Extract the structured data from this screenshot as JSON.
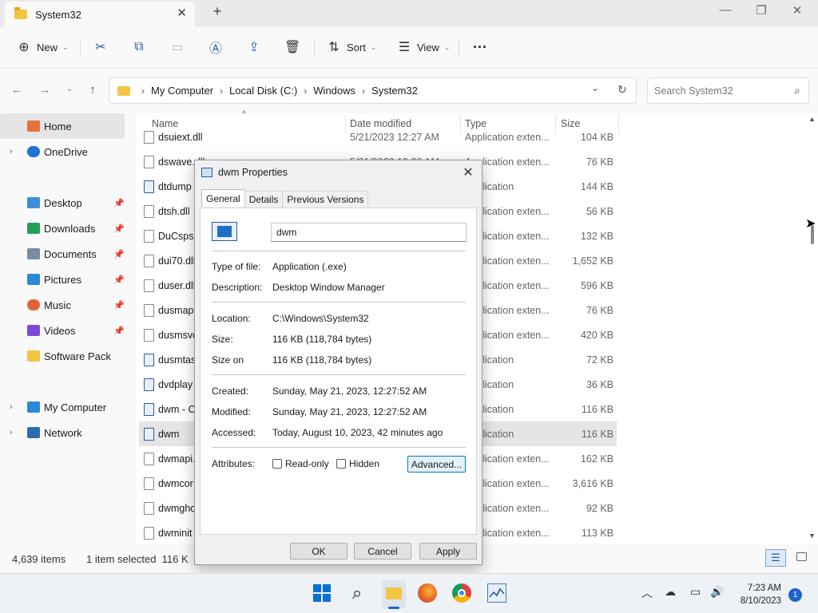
{
  "window": {
    "tab_title": "System32",
    "new_tab": "+",
    "minimize": "—",
    "maximize": "❐",
    "close": "✕"
  },
  "toolbar": {
    "new_label": "New",
    "sort_label": "Sort",
    "view_label": "View",
    "more": "···"
  },
  "address": {
    "crumbs": [
      "My Computer",
      "Local Disk (C:)",
      "Windows",
      "System32"
    ],
    "search_placeholder": "Search System32"
  },
  "sidebar": {
    "items": [
      {
        "label": "Home",
        "icon": "home-icon",
        "color": "#e8733a"
      },
      {
        "label": "OneDrive",
        "icon": "cloud-icon",
        "color": "#1e73d3"
      },
      {
        "label": "Desktop",
        "icon": "desktop-icon",
        "color": "#3b8fd6"
      },
      {
        "label": "Downloads",
        "icon": "download-icon",
        "color": "#22a05a"
      },
      {
        "label": "Documents",
        "icon": "documents-icon",
        "color": "#7c8aa3"
      },
      {
        "label": "Pictures",
        "icon": "pictures-icon",
        "color": "#2b88d8"
      },
      {
        "label": "Music",
        "icon": "music-icon",
        "color": "#e0643a"
      },
      {
        "label": "Videos",
        "icon": "videos-icon",
        "color": "#7b4bd6"
      },
      {
        "label": "Software Pack",
        "icon": "folder-icon",
        "color": "#f4c542"
      },
      {
        "label": "My Computer",
        "icon": "computer-icon",
        "color": "#2b88d8"
      },
      {
        "label": "Network",
        "icon": "network-icon",
        "color": "#2b6cb0"
      }
    ]
  },
  "filelist": {
    "columns": {
      "name": "Name",
      "date": "Date modified",
      "type": "Type",
      "size": "Size"
    },
    "rows": [
      {
        "name": "dsuiext.dll",
        "date": "5/21/2023 12:27 AM",
        "type": "Application exten...",
        "size": "104 KB",
        "icon": "dll"
      },
      {
        "name": "dswave.dll",
        "date": "5/21/2023 12:28 AM",
        "type": "Application exten...",
        "size": "76 KB",
        "icon": "dll"
      },
      {
        "name": "dtdump",
        "type": "Application",
        "size": "144 KB",
        "icon": "app"
      },
      {
        "name": "dtsh.dll",
        "type": "Application exten...",
        "size": "56 KB",
        "icon": "dll"
      },
      {
        "name": "DuCsps.d",
        "type": "Application exten...",
        "size": "132 KB",
        "icon": "dll"
      },
      {
        "name": "dui70.dll",
        "type": "Application exten...",
        "size": "1,652 KB",
        "icon": "dll"
      },
      {
        "name": "duser.dll",
        "type": "Application exten...",
        "size": "596 KB",
        "icon": "dll"
      },
      {
        "name": "dusmapi",
        "type": "Application exten...",
        "size": "76 KB",
        "icon": "dll"
      },
      {
        "name": "dusmsvc",
        "type": "Application exten...",
        "size": "420 KB",
        "icon": "dll"
      },
      {
        "name": "dusmtas",
        "type": "Application",
        "size": "72 KB",
        "icon": "app"
      },
      {
        "name": "dvdplay",
        "type": "Application",
        "size": "36 KB",
        "icon": "app"
      },
      {
        "name": "dwm - C",
        "type": "Application",
        "size": "116 KB",
        "icon": "app"
      },
      {
        "name": "dwm",
        "type": "Application",
        "size": "116 KB",
        "icon": "app"
      },
      {
        "name": "dwmapi.",
        "type": "Application exten...",
        "size": "162 KB",
        "icon": "dll"
      },
      {
        "name": "dwmcor",
        "type": "Application exten...",
        "size": "3,616 KB",
        "icon": "dll"
      },
      {
        "name": "dwmghc",
        "type": "Application exten...",
        "size": "92 KB",
        "icon": "dll"
      },
      {
        "name": "dwminit",
        "type": "Application exten...",
        "size": "113 KB",
        "icon": "dll"
      }
    ],
    "selected_index": 12
  },
  "status": {
    "items_count": "4,639 items",
    "selected": "1 item selected  116 K"
  },
  "dialog": {
    "title": "dwm Properties",
    "tabs": [
      "General",
      "Details",
      "Previous Versions"
    ],
    "name_value": "dwm",
    "type_label": "Type of file:",
    "type_value": "Application (.exe)",
    "desc_label": "Description:",
    "desc_value": "Desktop Window Manager",
    "loc_label": "Location:",
    "loc_value": "C:\\Windows\\System32",
    "size_label": "Size:",
    "size_value": "116 KB (118,784 bytes)",
    "sizeon_label": "Size on",
    "sizeon_value": "116 KB (118,784 bytes)",
    "created_label": "Created:",
    "created_value": "Sunday, May 21, 2023, 12:27:52 AM",
    "modified_label": "Modified:",
    "modified_value": "Sunday, May 21, 2023, 12:27:52 AM",
    "accessed_label": "Accessed:",
    "accessed_value": "Today, August 10, 2023, 42 minutes ago",
    "attr_label": "Attributes:",
    "readonly_label": "Read-only",
    "hidden_label": "Hidden",
    "advanced_label": "Advanced...",
    "ok_label": "OK",
    "cancel_label": "Cancel",
    "apply_label": "Apply"
  },
  "taskbar": {
    "time": "7:23 AM",
    "date": "8/10/2023",
    "notifications": "1"
  }
}
